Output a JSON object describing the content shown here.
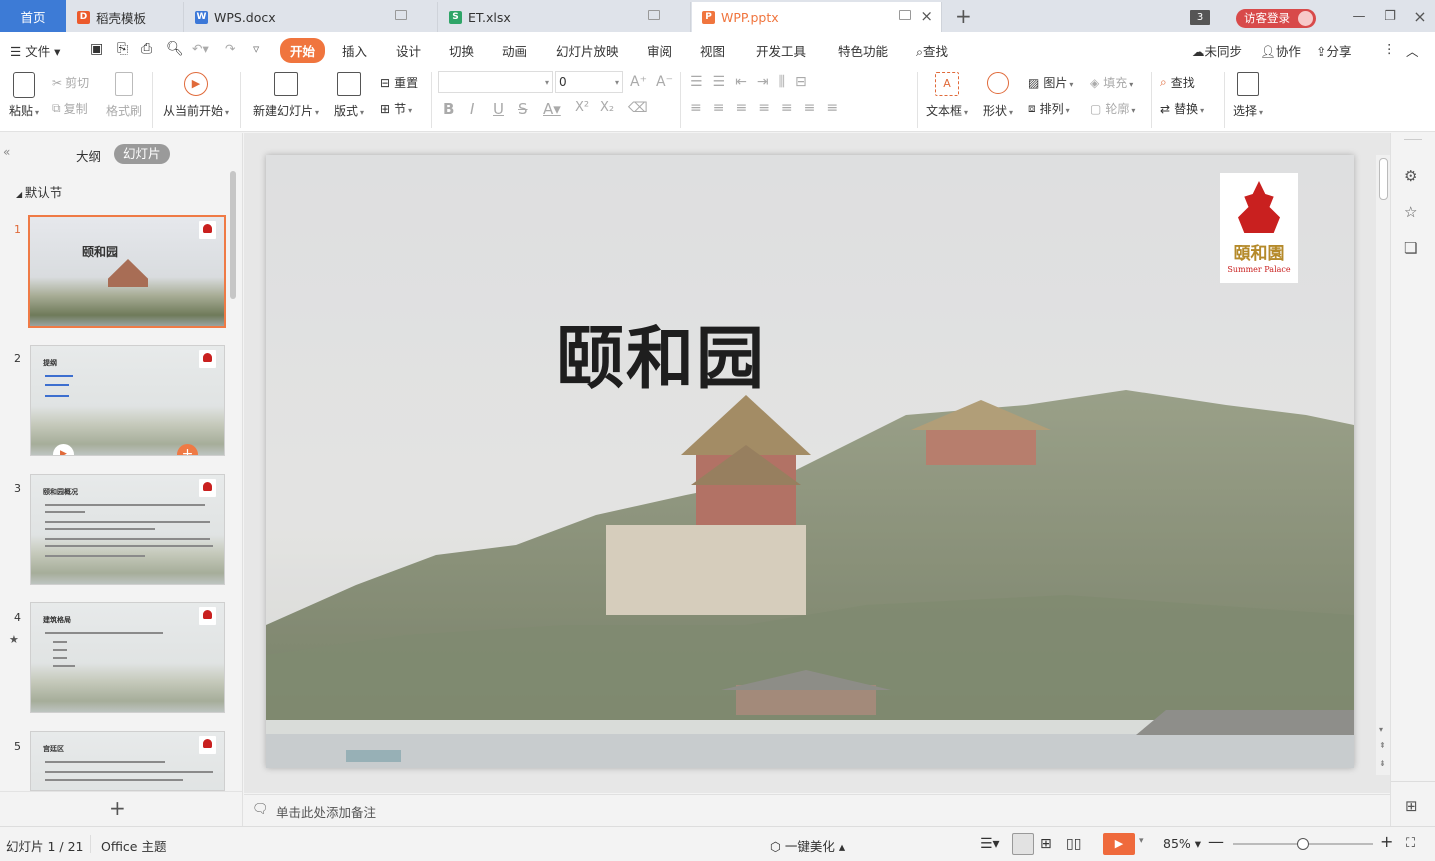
{
  "tabs": [
    {
      "label": "首页"
    },
    {
      "label": "稻壳模板"
    },
    {
      "label": "WPS.docx"
    },
    {
      "label": "ET.xlsx"
    },
    {
      "label": "WPP.pptx"
    }
  ],
  "titlebar": {
    "window_count": "3",
    "login_label": "访客登录"
  },
  "menu": {
    "file": "文件",
    "items": [
      "开始",
      "插入",
      "设计",
      "切换",
      "动画",
      "幻灯片放映",
      "审阅",
      "视图",
      "开发工具",
      "特色功能"
    ],
    "search": "查找",
    "sync": "未同步",
    "collab": "协作",
    "share": "分享"
  },
  "ribbon": {
    "paste": "粘贴",
    "cut": "剪切",
    "copy": "复制",
    "format_painter": "格式刷",
    "from_current": "从当前开始",
    "new_slide": "新建幻灯片",
    "layout": "版式",
    "reset": "重置",
    "section": "节",
    "font_size": "0",
    "textbox": "文本框",
    "shape": "形状",
    "picture": "图片",
    "fill": "填充",
    "arrange": "排列",
    "outline": "轮廓",
    "find": "查找",
    "replace": "替换",
    "select": "选择"
  },
  "panel": {
    "tab_outline": "大纲",
    "tab_slides": "幻灯片",
    "section_name": "默认节",
    "thumbs": [
      {
        "num": "1",
        "title": "颐和园"
      },
      {
        "num": "2",
        "title": "提纲"
      },
      {
        "num": "3",
        "title": "颐和园概况"
      },
      {
        "num": "4",
        "title": "建筑格局"
      },
      {
        "num": "5",
        "title": "宫廷区"
      }
    ]
  },
  "slide": {
    "title": "颐和园",
    "logo_text": "頤和園",
    "logo_sub": "Summer Palace"
  },
  "notes_placeholder": "单击此处添加备注",
  "status": {
    "slide_info": "幻灯片 1 / 21",
    "theme": "Office 主题",
    "beautify": "一键美化",
    "zoom": "85%"
  },
  "colors": {
    "accent": "#f0753e",
    "home_tab": "#3d7bd6",
    "logo_red": "#c9201f"
  }
}
